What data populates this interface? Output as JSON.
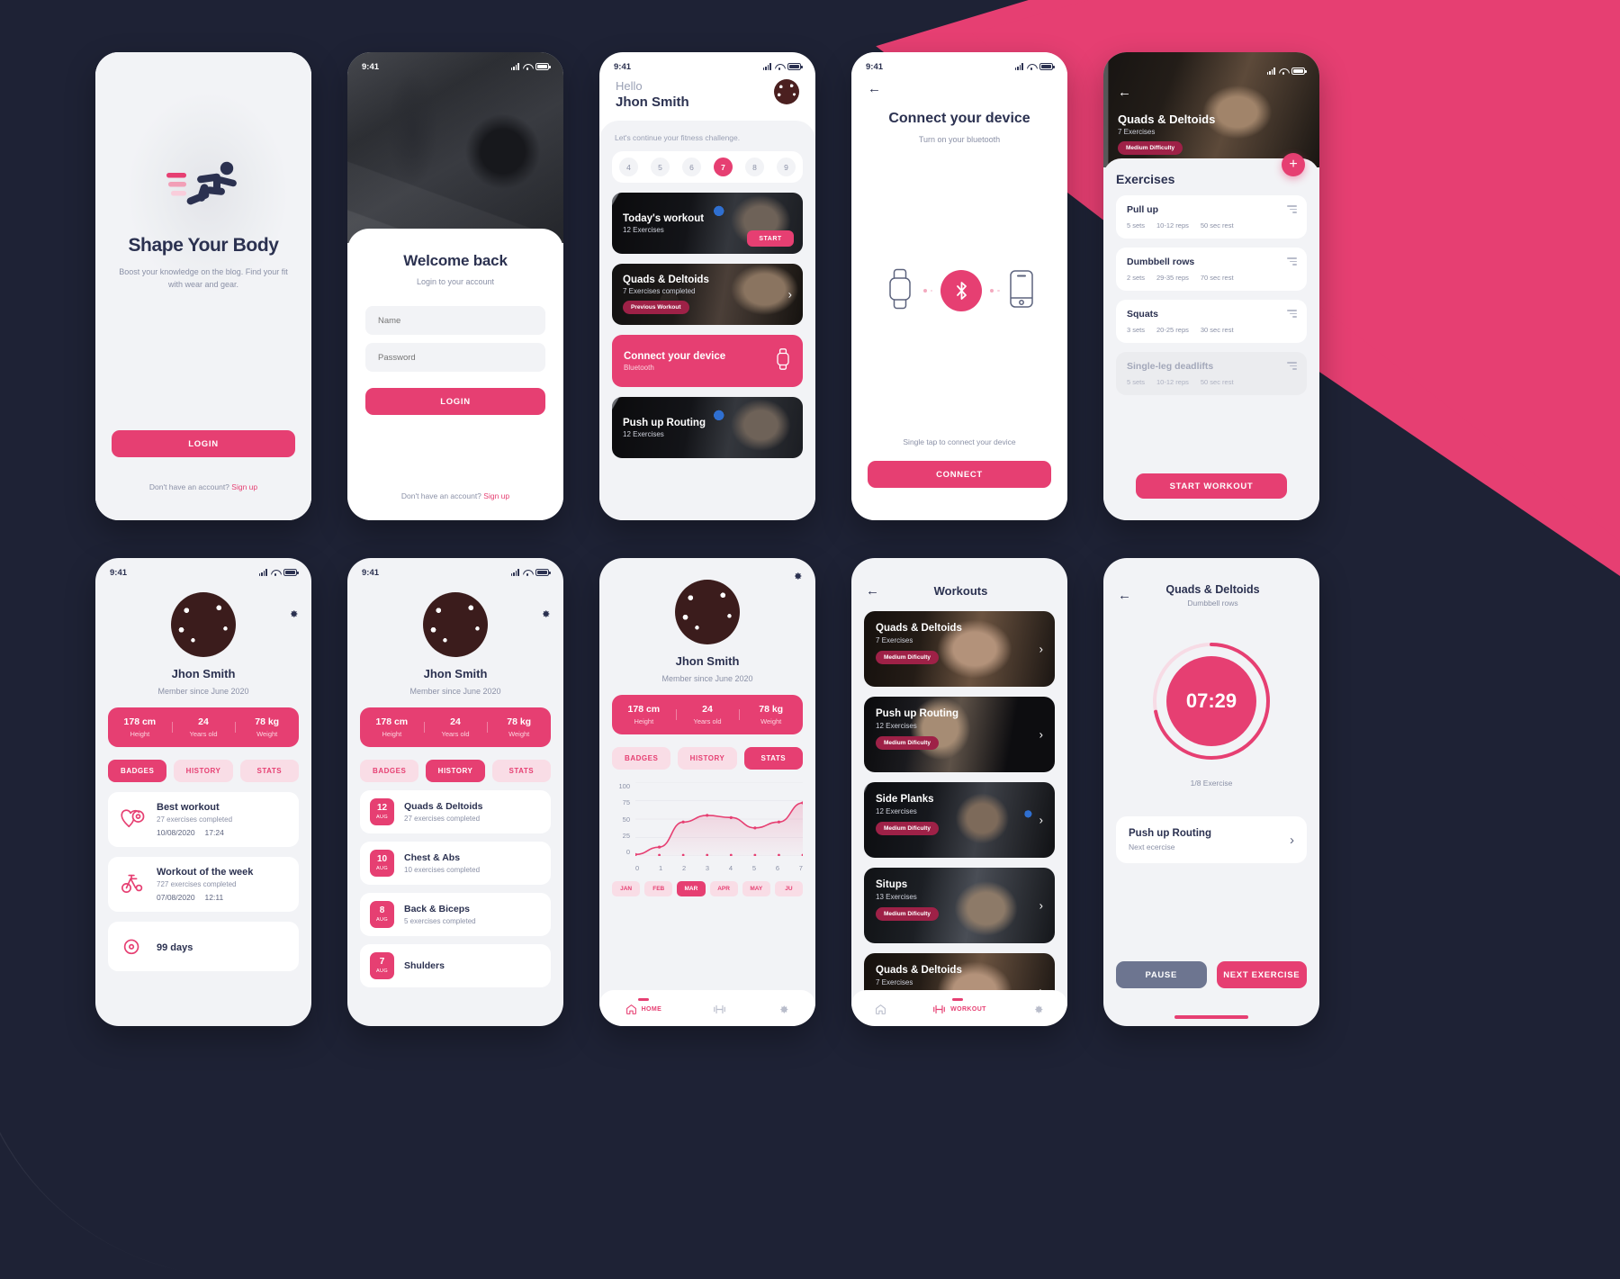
{
  "theme": {
    "accent": "#e63f72",
    "dark": "#1e2235",
    "light_bg": "#f2f3f6",
    "text": "#2b3150",
    "muted": "#8a90a6"
  },
  "status_bar": {
    "time": "9:41"
  },
  "splash": {
    "title": "Shape Your Body",
    "description": "Boost your knowledge on the blog. Find your fit with wear and gear.",
    "login_label": "LOGIN",
    "signup_prompt": "Don't have an account?",
    "signup_link": "Sign up"
  },
  "login": {
    "title": "Welcome back",
    "subtitle": "Login to your account",
    "name_placeholder": "Name",
    "password_placeholder": "Password",
    "login_label": "LOGIN",
    "signup_prompt": "Don't have an account?",
    "signup_link": "Sign up"
  },
  "home": {
    "greeting": "Hello",
    "user_name": "Jhon Smith",
    "continue_text": "Let's continue your fitness challenge.",
    "days": [
      "4",
      "5",
      "6",
      "7",
      "8",
      "9"
    ],
    "active_day": "7",
    "today": {
      "title": "Today's workout",
      "subtitle": "12 Exercises",
      "start_label": "START"
    },
    "previous": {
      "title": "Quads & Deltoids",
      "subtitle": "7 Exercises completed",
      "badge": "Previous Workout"
    },
    "connect": {
      "title": "Connect your device",
      "subtitle": "Bluetooth"
    },
    "pushup": {
      "title": "Push up Routing",
      "subtitle": "12 Exercises"
    }
  },
  "bluetooth": {
    "title": "Connect your device",
    "subtitle": "Turn on your bluetooth",
    "hint": "Single tap to connect your device",
    "connect_label": "CONNECT"
  },
  "exercises": {
    "hero_title": "Quads & Deltoids",
    "hero_subtitle": "7 Exercises",
    "hero_badge": "Medium Difficulty",
    "section_title": "Exercises",
    "start_label": "START WORKOUT",
    "items": [
      {
        "name": "Pull up",
        "sets": "5 sets",
        "reps": "10-12 reps",
        "rest": "50 sec rest",
        "dim": false
      },
      {
        "name": "Dumbbell rows",
        "sets": "2 sets",
        "reps": "29-35 reps",
        "rest": "70 sec rest",
        "dim": false
      },
      {
        "name": "Squats",
        "sets": "3 sets",
        "reps": "20-25 reps",
        "rest": "30 sec rest",
        "dim": false
      },
      {
        "name": "Single-leg deadlifts",
        "sets": "5 sets",
        "reps": "10-12 reps",
        "rest": "50 sec rest",
        "dim": true
      }
    ]
  },
  "profile": {
    "name": "Jhon Smith",
    "member_since": "Member since June 2020",
    "stats": [
      {
        "value": "178 cm",
        "label": "Height"
      },
      {
        "value": "24",
        "label": "Years old"
      },
      {
        "value": "78 kg",
        "label": "Weight"
      }
    ],
    "tabs": [
      "BADGES",
      "HISTORY",
      "STATS"
    ]
  },
  "badges": {
    "items": [
      {
        "title": "Best workout",
        "subtitle": "27 exercises completed",
        "date": "10/08/2020",
        "time": "17:24"
      },
      {
        "title": "Workout of the week",
        "subtitle": "727 exercises completed",
        "date": "07/08/2020",
        "time": "12:11"
      },
      {
        "title": "99 days",
        "subtitle": "",
        "date": "",
        "time": ""
      }
    ]
  },
  "history": {
    "items": [
      {
        "day": "12",
        "month": "AUG",
        "title": "Quads & Deltoids",
        "subtitle": "27 exercises completed"
      },
      {
        "day": "10",
        "month": "AUG",
        "title": "Chest & Abs",
        "subtitle": "10 exercises completed"
      },
      {
        "day": "8",
        "month": "AUG",
        "title": "Back & Biceps",
        "subtitle": "5 exercises completed"
      },
      {
        "day": "7",
        "month": "AUG",
        "title": "Shulders",
        "subtitle": ""
      }
    ]
  },
  "chart_data": {
    "type": "area",
    "title": "",
    "xlabel": "",
    "ylabel": "",
    "x": [
      0,
      1,
      2,
      3,
      4,
      5,
      6,
      7
    ],
    "values": [
      2,
      12,
      46,
      55,
      52,
      38,
      46,
      72
    ],
    "ytick_labels": [
      "100",
      "75",
      "50",
      "25",
      "0"
    ],
    "yticks": [
      100,
      75,
      50,
      25,
      0
    ],
    "xtick_labels": [
      "0",
      "1",
      "2",
      "3",
      "4",
      "5",
      "6",
      "7"
    ],
    "ylim": [
      0,
      100
    ],
    "grid": true,
    "legend": "none",
    "series": [
      {
        "name": "exercises",
        "values": [
          2,
          12,
          46,
          55,
          52,
          38,
          46,
          72
        ]
      }
    ],
    "months": [
      "JAN",
      "FEB",
      "MAR",
      "APR",
      "MAY",
      "JU"
    ],
    "active_month": "MAR"
  },
  "tabbar": {
    "home": "HOME",
    "workout": "WORKOUT"
  },
  "workouts": {
    "title": "Workouts",
    "items": [
      {
        "title": "Quads & Deltoids",
        "subtitle": "7 Exercises",
        "difficulty": "Medium Dificulty"
      },
      {
        "title": "Push up Routing",
        "subtitle": "12 Exercises",
        "difficulty": "Medium Dificulty"
      },
      {
        "title": "Side Planks",
        "subtitle": "12 Exercises",
        "difficulty": "Medium Dificulty"
      },
      {
        "title": "Situps",
        "subtitle": "13 Exercises",
        "difficulty": "Medium Dificulty"
      },
      {
        "title": "Quads & Deltoids",
        "subtitle": "7 Exercises",
        "difficulty": ""
      }
    ]
  },
  "timer": {
    "title": "Quads & Deltoids",
    "subtitle": "Dumbbell rows",
    "value": "07:29",
    "progress_percent": 72,
    "counter": "1/8 Exercise",
    "next_title": "Push up Routing",
    "next_label": "Next ecercise",
    "pause_label": "PAUSE",
    "next_button_label": "NEXT EXERCISE"
  }
}
